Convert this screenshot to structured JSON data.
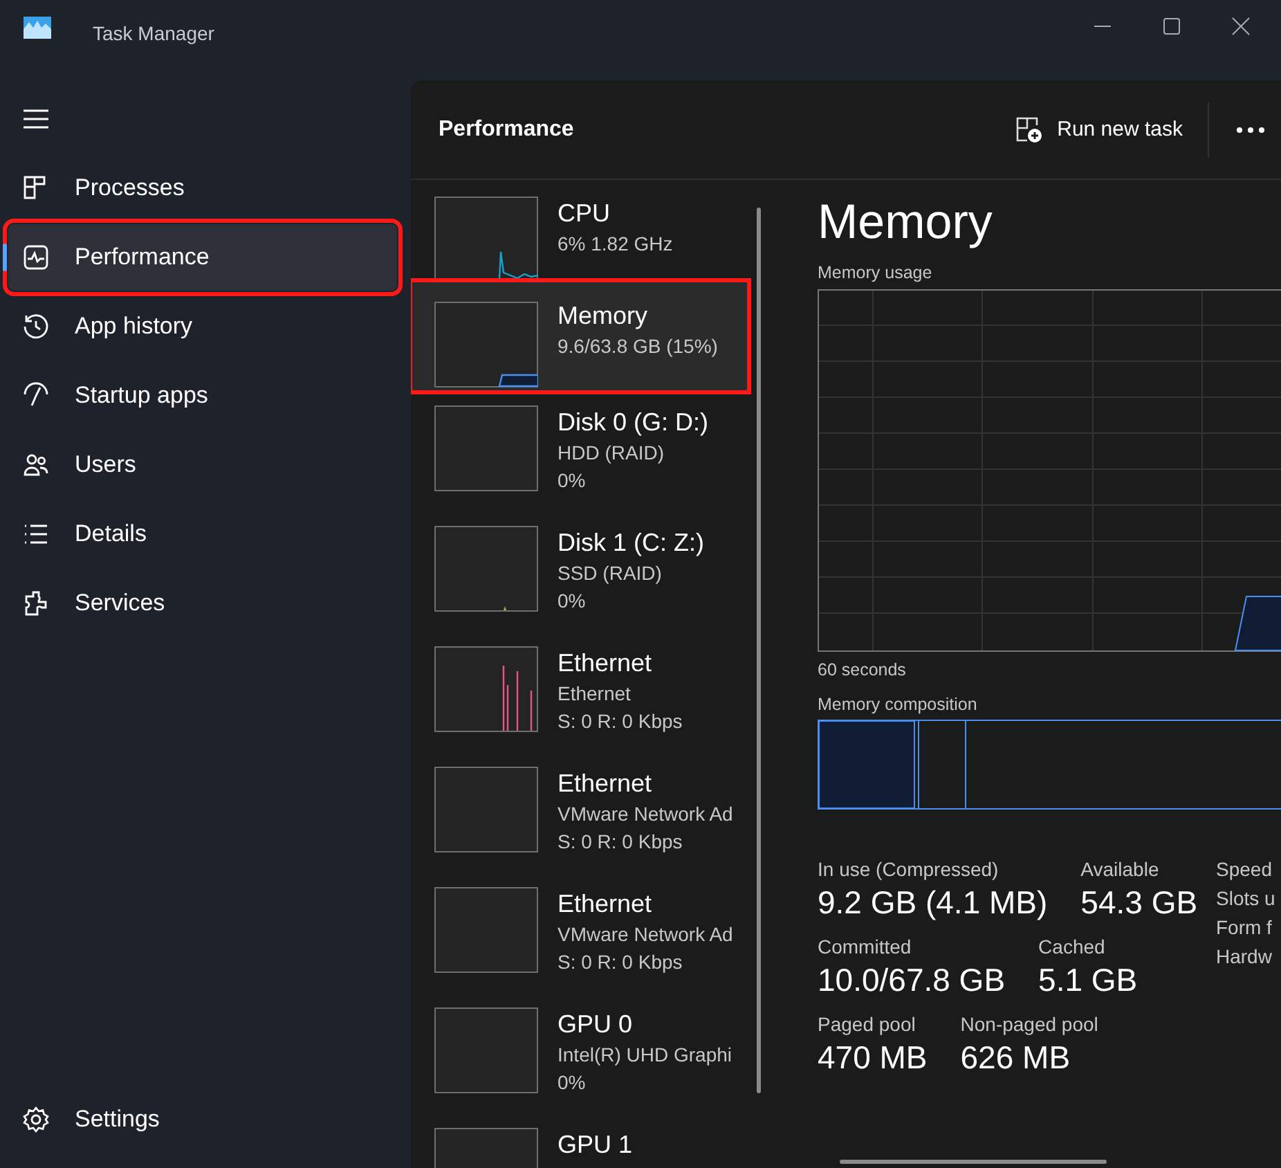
{
  "window": {
    "title": "Task Manager"
  },
  "sidebar": {
    "items": [
      {
        "label": "Processes",
        "selected": false,
        "annotated": false
      },
      {
        "label": "Performance",
        "selected": true,
        "annotated": true
      },
      {
        "label": "App history",
        "selected": false,
        "annotated": false
      },
      {
        "label": "Startup apps",
        "selected": false,
        "annotated": false
      },
      {
        "label": "Users",
        "selected": false,
        "annotated": false
      },
      {
        "label": "Details",
        "selected": false,
        "annotated": false
      },
      {
        "label": "Services",
        "selected": false,
        "annotated": false
      }
    ],
    "settings": {
      "label": "Settings"
    }
  },
  "header": {
    "title": "Performance",
    "run_task": "Run new task"
  },
  "devices": [
    {
      "name": "CPU",
      "lines": [
        "6%  1.82 GHz"
      ],
      "kind": "cpu",
      "selected": false,
      "annotated": false
    },
    {
      "name": "Memory",
      "lines": [
        "9.6/63.8 GB (15%)"
      ],
      "kind": "memory",
      "selected": true,
      "annotated": true
    },
    {
      "name": "Disk 0 (G: D:)",
      "lines": [
        "HDD (RAID)",
        "0%"
      ],
      "kind": "flat",
      "selected": false,
      "annotated": false
    },
    {
      "name": "Disk 1 (C: Z:)",
      "lines": [
        "SSD (RAID)",
        "0%"
      ],
      "kind": "blip",
      "selected": false,
      "annotated": false
    },
    {
      "name": "Ethernet",
      "lines": [
        "Ethernet",
        "S: 0 R: 0 Kbps"
      ],
      "kind": "spikes",
      "selected": false,
      "annotated": false
    },
    {
      "name": "Ethernet",
      "lines": [
        "VMware Network Ad",
        "S: 0 R: 0 Kbps"
      ],
      "kind": "flat",
      "selected": false,
      "annotated": false
    },
    {
      "name": "Ethernet",
      "lines": [
        "VMware Network Ad",
        "S: 0 R: 0 Kbps"
      ],
      "kind": "flat",
      "selected": false,
      "annotated": false
    },
    {
      "name": "GPU 0",
      "lines": [
        "Intel(R) UHD Graphi",
        "0%"
      ],
      "kind": "flat",
      "selected": false,
      "annotated": false
    },
    {
      "name": "GPU 1",
      "kind": "flat",
      "selected": false,
      "annotated": false
    }
  ],
  "detail": {
    "title": "Memory",
    "usage_label": "Memory usage",
    "time_label": "60 seconds",
    "composition_label": "Memory composition",
    "stat_rows": [
      [
        {
          "label": "In use (Compressed)",
          "value": "9.2 GB (4.1 MB)"
        },
        {
          "label": "Available",
          "value": "54.3 GB"
        }
      ],
      [
        {
          "label": "Committed",
          "value": "10.0/67.8 GB"
        },
        {
          "label": "Cached",
          "value": "5.1 GB"
        }
      ],
      [
        {
          "label": "Paged pool",
          "value": "470 MB"
        },
        {
          "label": "Non-paged pool",
          "value": "626 MB"
        }
      ]
    ],
    "side_labels": [
      "Speed",
      "Slots u",
      "Form f",
      "Hardw"
    ]
  }
}
